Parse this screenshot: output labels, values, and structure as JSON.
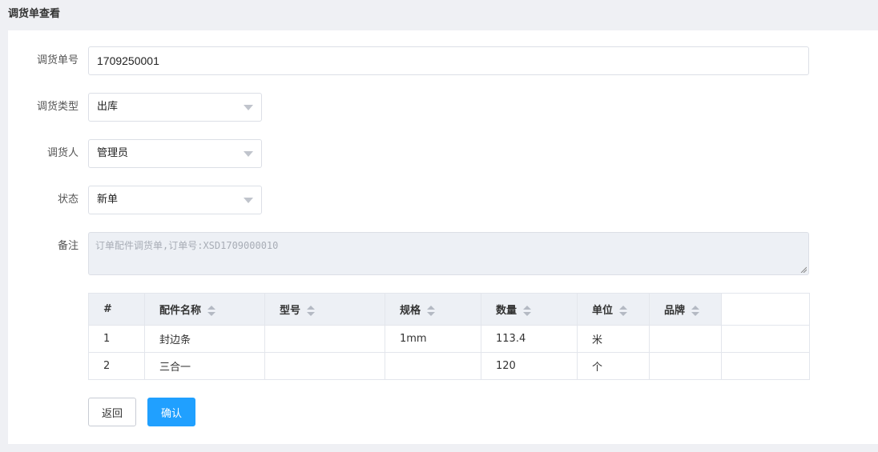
{
  "page": {
    "title": "调货单查看"
  },
  "form": {
    "order_no": {
      "label": "调货单号",
      "value": "1709250001"
    },
    "type": {
      "label": "调货类型",
      "value": "出库"
    },
    "person": {
      "label": "调货人",
      "value": "管理员"
    },
    "status": {
      "label": "状态",
      "value": "新单"
    },
    "remark": {
      "label": "备注",
      "placeholder": "订单配件调货单,订单号:XSD1709000010"
    }
  },
  "table": {
    "columns": [
      "#",
      "配件名称",
      "型号",
      "规格",
      "数量",
      "单位",
      "品牌"
    ],
    "rows": [
      [
        "1",
        "封边条",
        "",
        "1mm",
        "113.4",
        "米",
        ""
      ],
      [
        "2",
        "三合一",
        "",
        "",
        "120",
        "个",
        ""
      ]
    ]
  },
  "actions": {
    "back_label": "返回",
    "confirm_label": "确认"
  },
  "colors": {
    "primary": "#20a0ff",
    "background": "#eff0f4",
    "table_header": "#edf0f5"
  }
}
